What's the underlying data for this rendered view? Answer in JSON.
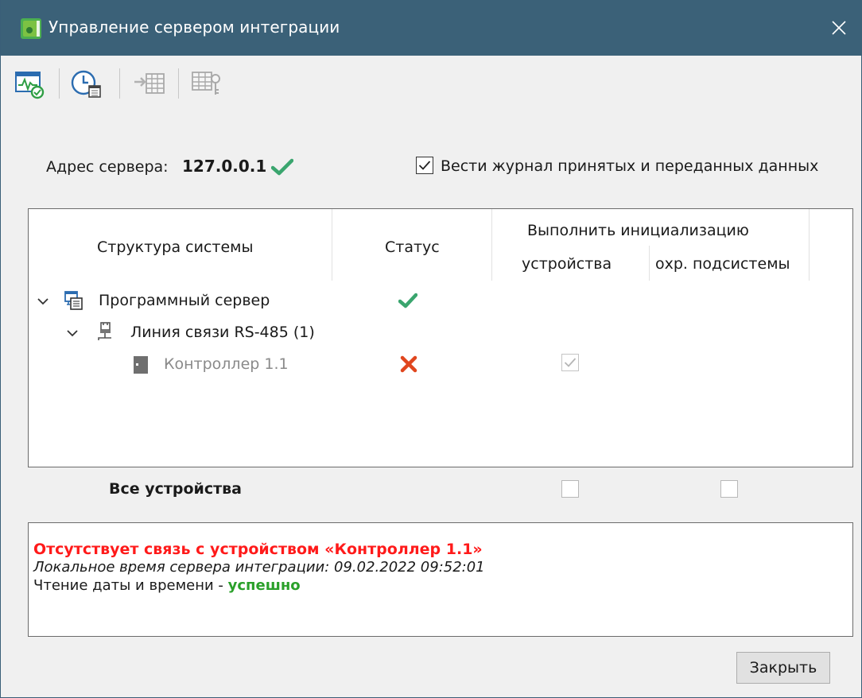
{
  "window": {
    "title": "Управление сервером интеграции",
    "close_glyph": "✕"
  },
  "toolbar": {
    "buttons": [
      {
        "icon": "monitor-refresh-icon",
        "enabled": true
      },
      {
        "icon": "clock-calendar-icon",
        "enabled": true
      },
      {
        "icon": "import-grid-icon",
        "enabled": false
      },
      {
        "icon": "grid-key-icon",
        "enabled": false
      }
    ]
  },
  "server": {
    "address_label": "Адрес сервера:",
    "address_value": "127.0.0.1",
    "status": "ok"
  },
  "logging": {
    "checked": true,
    "label": "Вести журнал принятых и переданных данных"
  },
  "tree": {
    "headers": {
      "structure": "Структура системы",
      "status": "Статус",
      "init_group": "Выполнить инициализацию",
      "init_devices": "устройства",
      "init_subsystems": "охр. подсистемы"
    },
    "nodes": [
      {
        "label": "Программный сервер",
        "icon": "server-icon",
        "status": "ok",
        "expanded": true
      },
      {
        "label": "Линия связи RS-485 (1)",
        "icon": "connector-icon",
        "status": "",
        "expanded": true
      },
      {
        "label": "Контроллер 1.1",
        "icon": "controller-icon",
        "status": "error",
        "init_devices": true,
        "init_subsystems": null
      }
    ]
  },
  "all_devices": {
    "label": "Все устройства",
    "init_devices": false,
    "init_subsystems": false
  },
  "messages": {
    "line1": "Отсутствует связь с устройством «Контроллер 1.1»",
    "line2": "Локальное время сервера интеграции: 09.02.2022 09:52:01",
    "line3_prefix": "Чтение даты и времени - ",
    "line3_status": "успешно"
  },
  "buttons": {
    "close": "Закрыть"
  },
  "colors": {
    "titlebar": "#3b6178",
    "ok_green": "#3aa56e",
    "error_red": "#e0461e",
    "message_red": "#ff1a1a",
    "success_green": "#2aa02a"
  }
}
